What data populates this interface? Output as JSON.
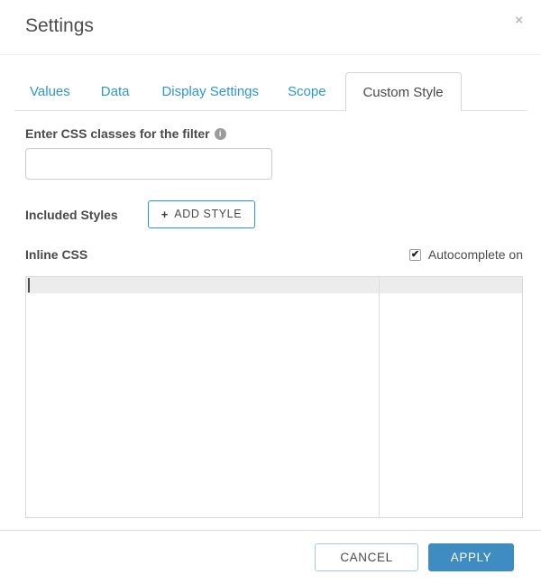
{
  "dialog": {
    "title": "Settings"
  },
  "icons": {
    "close": "×",
    "info": "i",
    "plus": "+",
    "check": "✔"
  },
  "tabs": {
    "items": [
      {
        "label": "Values",
        "active": false
      },
      {
        "label": "Data",
        "active": false
      },
      {
        "label": "Display Settings",
        "active": false
      },
      {
        "label": "Scope",
        "active": false
      },
      {
        "label": "Custom Style",
        "active": true
      }
    ]
  },
  "filter": {
    "label": "Enter CSS classes for the filter",
    "value": "",
    "placeholder": ""
  },
  "included_styles": {
    "label": "Included Styles",
    "add_button_label": "ADD STYLE"
  },
  "inline_css": {
    "label": "Inline CSS",
    "autocomplete_label": "Autocomplete on",
    "autocomplete_checked": true,
    "editor_value": ""
  },
  "footer": {
    "cancel_label": "CANCEL",
    "apply_label": "APPLY"
  },
  "colors": {
    "tab_link_blue": "#2e95d3",
    "apply_blue": "#3e8cc2",
    "active_line_gray": "#ececec"
  }
}
